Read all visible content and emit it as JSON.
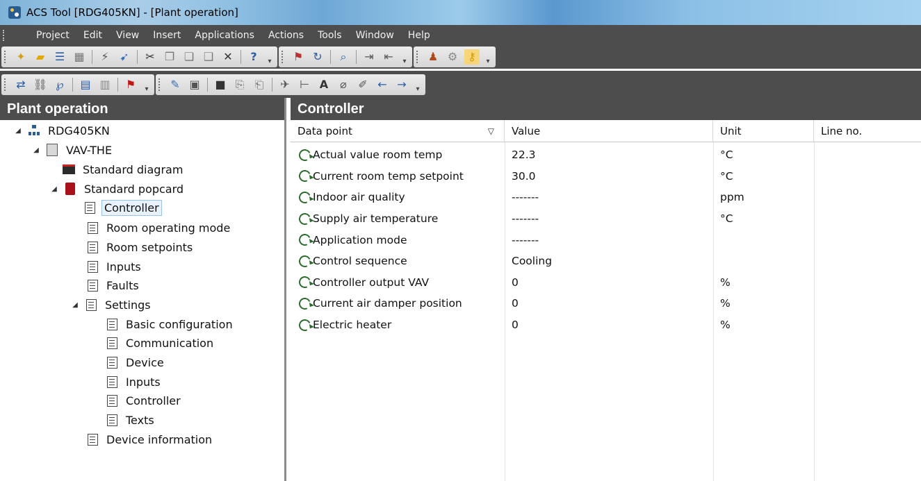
{
  "window": {
    "title": "ACS Tool [RDG405KN] - [Plant operation]"
  },
  "menubar": {
    "items": [
      "Project",
      "Edit",
      "View",
      "Insert",
      "Applications",
      "Actions",
      "Tools",
      "Window",
      "Help"
    ]
  },
  "left_pane": {
    "title": "Plant operation",
    "tree": {
      "root": "RDG405KN",
      "device": "VAV-THE",
      "standard_diagram": "Standard diagram",
      "standard_popcard": "Standard popcard",
      "controller": "Controller",
      "room_operating_mode": "Room operating mode",
      "room_setpoints": "Room setpoints",
      "inputs": "Inputs",
      "faults": "Faults",
      "settings": "Settings",
      "basic_configuration": "Basic configuration",
      "communication": "Communication",
      "settings_device": "Device",
      "settings_inputs": "Inputs",
      "settings_controller": "Controller",
      "texts": "Texts",
      "device_information": "Device information"
    }
  },
  "right_pane": {
    "title": "Controller",
    "columns": {
      "data_point": "Data point",
      "value": "Value",
      "unit": "Unit",
      "line_no": "Line no."
    },
    "rows": [
      {
        "data_point": "Actual value room temp",
        "value": "22.3",
        "unit": "°C",
        "line_no": ""
      },
      {
        "data_point": "Current room temp setpoint",
        "value": "30.0",
        "unit": "°C",
        "line_no": ""
      },
      {
        "data_point": "Indoor air quality",
        "value": "-------",
        "unit": "ppm",
        "line_no": ""
      },
      {
        "data_point": "Supply air temperature",
        "value": "-------",
        "unit": "°C",
        "line_no": ""
      },
      {
        "data_point": "Application mode",
        "value": "-------",
        "unit": "",
        "line_no": ""
      },
      {
        "data_point": "Control sequence",
        "value": "Cooling",
        "unit": "",
        "line_no": ""
      },
      {
        "data_point": "Controller output VAV",
        "value": "0",
        "unit": "%",
        "line_no": ""
      },
      {
        "data_point": "Current air damper position",
        "value": "0",
        "unit": "%",
        "line_no": ""
      },
      {
        "data_point": "Electric heater",
        "value": "0",
        "unit": "%",
        "line_no": ""
      }
    ]
  },
  "colors": {
    "toolbar_bg": "#4d4d4d",
    "header_text": "#ffffff",
    "refresh_icon": "#2a6a2a",
    "popcard_icon": "#a8101a"
  }
}
